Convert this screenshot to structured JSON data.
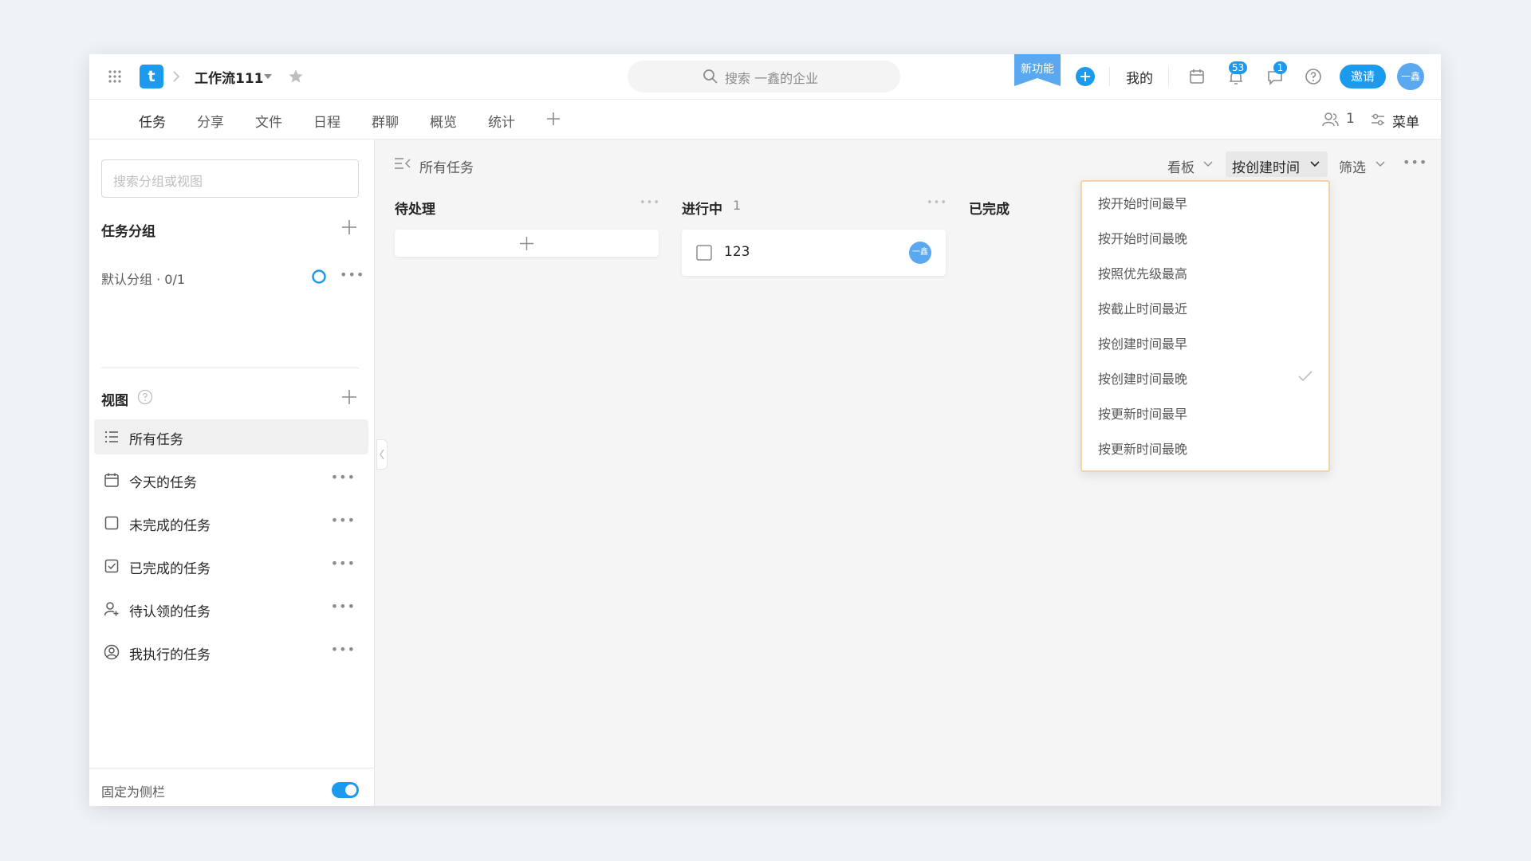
{
  "header": {
    "project_name": "工作流111",
    "search_placeholder": "搜索 一鑫的企业",
    "new_feature_label": "新功能",
    "mine_label": "我的",
    "notification_count": "53",
    "message_count": "1",
    "invite_label": "邀请",
    "avatar_text": "一鑫",
    "logo_letter": "t"
  },
  "tabs": [
    {
      "label": "任务"
    },
    {
      "label": "分享"
    },
    {
      "label": "文件"
    },
    {
      "label": "日程"
    },
    {
      "label": "群聊"
    },
    {
      "label": "概览"
    },
    {
      "label": "统计"
    }
  ],
  "tabs_right": {
    "member_count": "1",
    "menu_label": "菜单"
  },
  "sidebar": {
    "search_placeholder": "搜索分组或视图",
    "groups_title": "任务分组",
    "default_group": "默认分组 · 0/1",
    "views_title": "视图",
    "views": [
      {
        "label": "所有任务"
      },
      {
        "label": "今天的任务"
      },
      {
        "label": "未完成的任务"
      },
      {
        "label": "已完成的任务"
      },
      {
        "label": "待认领的任务"
      },
      {
        "label": "我执行的任务"
      }
    ],
    "pin_label": "固定为侧栏"
  },
  "main": {
    "breadcrumb": "所有任务",
    "view_mode": "看板",
    "sort_label": "按创建时间",
    "filter_label": "筛选",
    "columns": [
      {
        "title": "待处理",
        "count": ""
      },
      {
        "title": "进行中",
        "count": "1"
      },
      {
        "title": "已完成",
        "count": ""
      }
    ],
    "task": {
      "title": "123",
      "assignee": "一鑫"
    }
  },
  "sort_menu": {
    "items": [
      {
        "label": "按开始时间最早"
      },
      {
        "label": "按开始时间最晚"
      },
      {
        "label": "按照优先级最高"
      },
      {
        "label": "按截止时间最近"
      },
      {
        "label": "按创建时间最早"
      },
      {
        "label": "按创建时间最晚"
      },
      {
        "label": "按更新时间最早"
      },
      {
        "label": "按更新时间最晚"
      }
    ],
    "selected": "按创建时间最晚"
  },
  "colors": {
    "accent": "#1b9aee",
    "dropdown_border": "#f5d3a8"
  }
}
